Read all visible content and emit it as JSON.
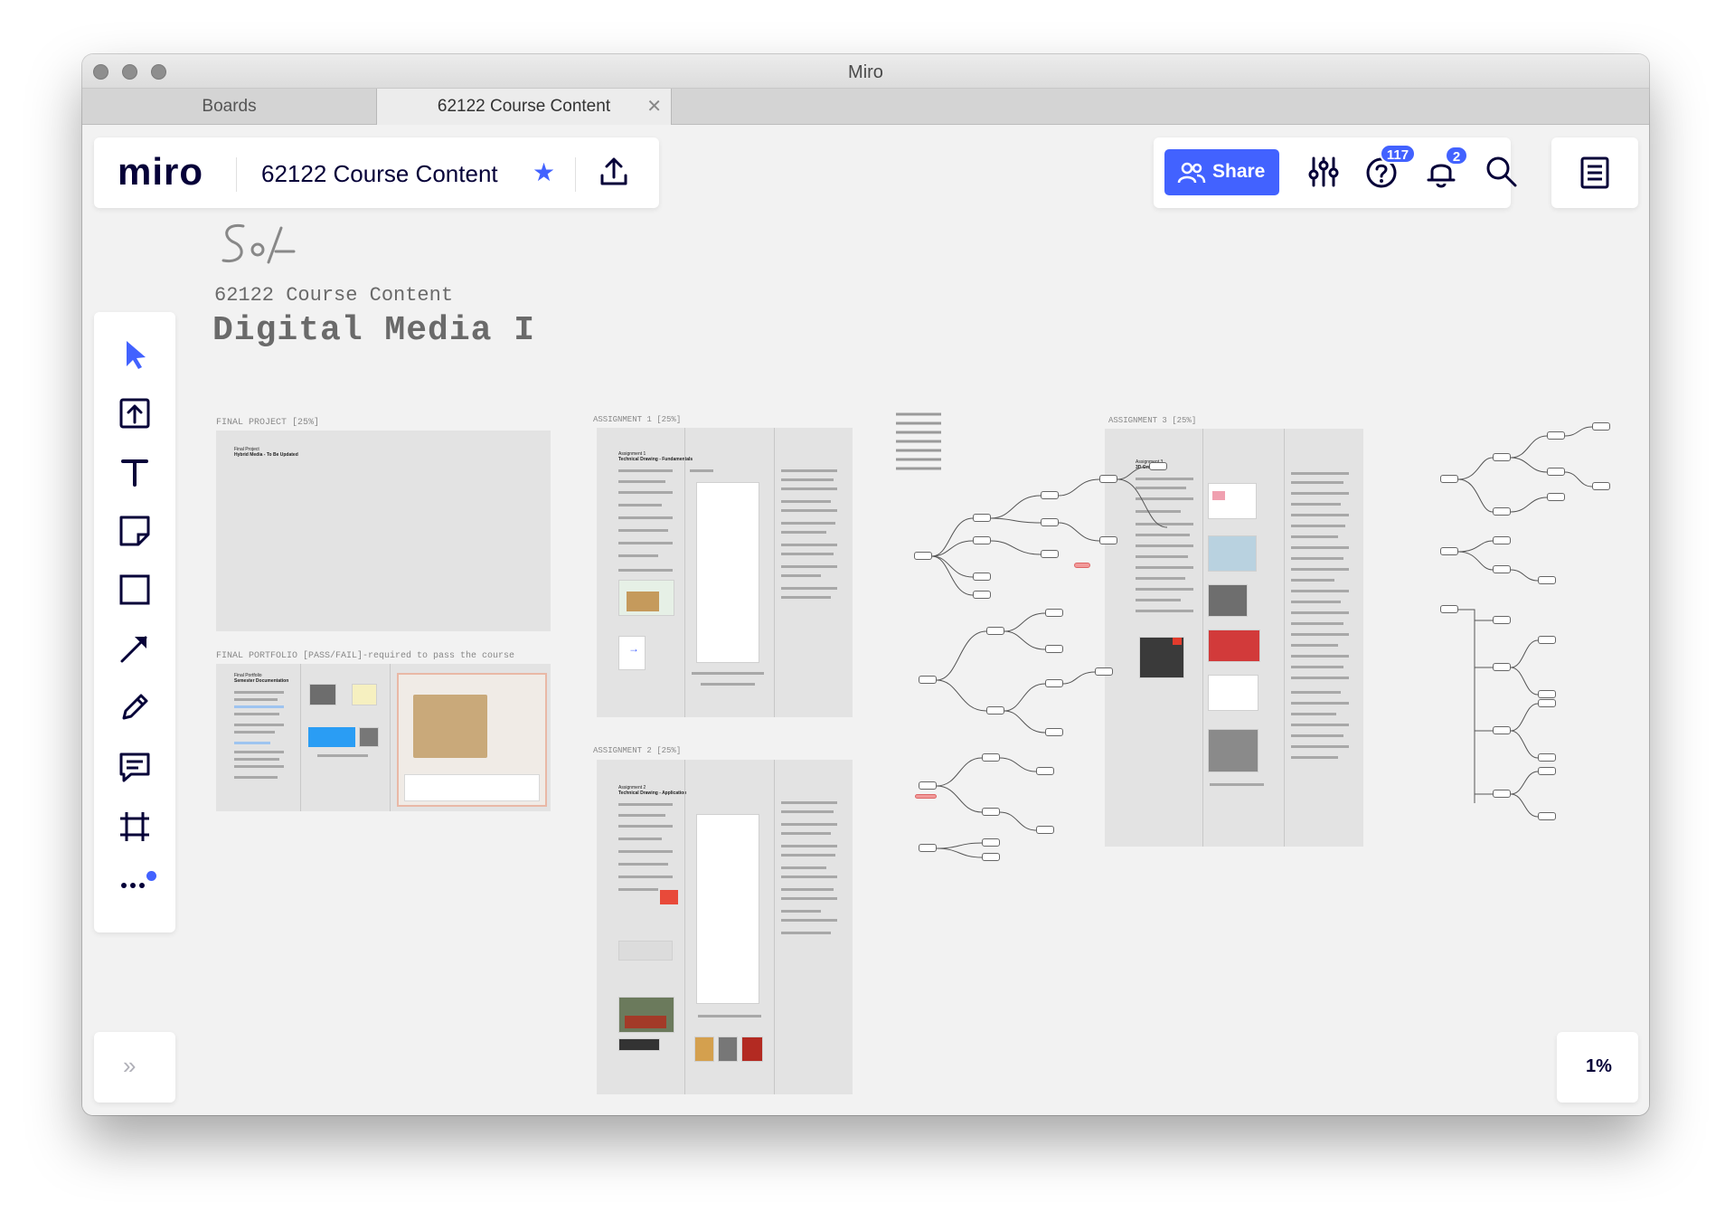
{
  "window": {
    "title": "Miro"
  },
  "tabs": [
    {
      "label": "Boards"
    },
    {
      "label": "62122 Course Content"
    }
  ],
  "header": {
    "logo": "miro",
    "board_title": "62122 Course Content",
    "share_label": "Share",
    "help_badge": "117",
    "notifications_badge": "2"
  },
  "zoom": {
    "level": "1%"
  },
  "board": {
    "logo_text": "So/-",
    "subtitle": "62122 Course Content",
    "heading": "Digital Media I",
    "frames": {
      "final_project": "FINAL PROJECT [25%]",
      "final_portfolio": "FINAL PORTFOLIO [PASS/FAIL]-required to pass the course",
      "assignment1": "ASSIGNMENT 1 [25%]",
      "assignment2": "ASSIGNMENT 2 [25%]",
      "assignment3": "ASSIGNMENT 3 [25%]"
    },
    "doc_titles": {
      "final_project": "Final Project",
      "final_project_sub": "Hybrid Media - To Be Updated",
      "final_portfolio": "Final Portfolio",
      "final_portfolio_sub": "Semester Documentation",
      "assignment1": "Assignment 1",
      "assignment1_sub": "Technical Drawing - Fundamentals",
      "assignment2": "Assignment 2",
      "assignment2_sub": "Technical Drawing - Application",
      "assignment3": "Assignment 3",
      "assignment3_sub": "3D Graphics"
    }
  },
  "colors": {
    "accent": "#4262ff",
    "logo": "#050038",
    "canvas": "#f2f2f2"
  },
  "icons": {
    "select": "cursor-arrow-icon",
    "upload": "upload-icon",
    "text": "text-icon",
    "sticky": "sticky-note-icon",
    "shape": "square-shape-icon",
    "line": "arrow-line-icon",
    "pen": "pen-icon",
    "comment": "comment-icon",
    "frame": "frame-icon",
    "more": "more-icon"
  }
}
